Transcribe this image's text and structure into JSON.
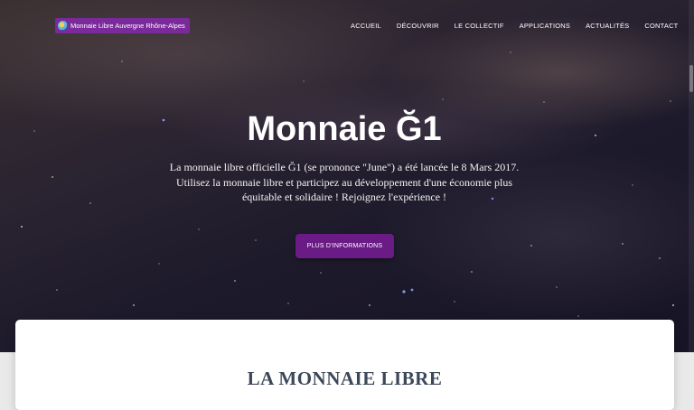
{
  "header": {
    "brand_label": "Monnaie Libre Auvergne Rhône-Alpes",
    "brand_color": "#7a2a9a",
    "logo_icon": "g1-logo-icon",
    "nav": [
      {
        "label": "ACCUEIL"
      },
      {
        "label": "DÉCOUVRIR"
      },
      {
        "label": "LE COLLECTIF"
      },
      {
        "label": "APPLICATIONS"
      },
      {
        "label": "ACTUALITÉS"
      },
      {
        "label": "CONTACT"
      }
    ]
  },
  "hero": {
    "title": "Monnaie Ğ1",
    "line1": "La monnaie libre officielle Ğ1 (se prononce \"June\") a été lancée le 8 Mars 2017.",
    "line2": "Utilisez la monnaie libre et participez au développement d'une économie plus équitable et solidaire ! Rejoignez l'expérience !",
    "cta_label": "PLUS D'INFORMATIONS",
    "cta_color": "#6a1b86"
  },
  "section": {
    "title": "LA MONNAIE LIBRE"
  }
}
